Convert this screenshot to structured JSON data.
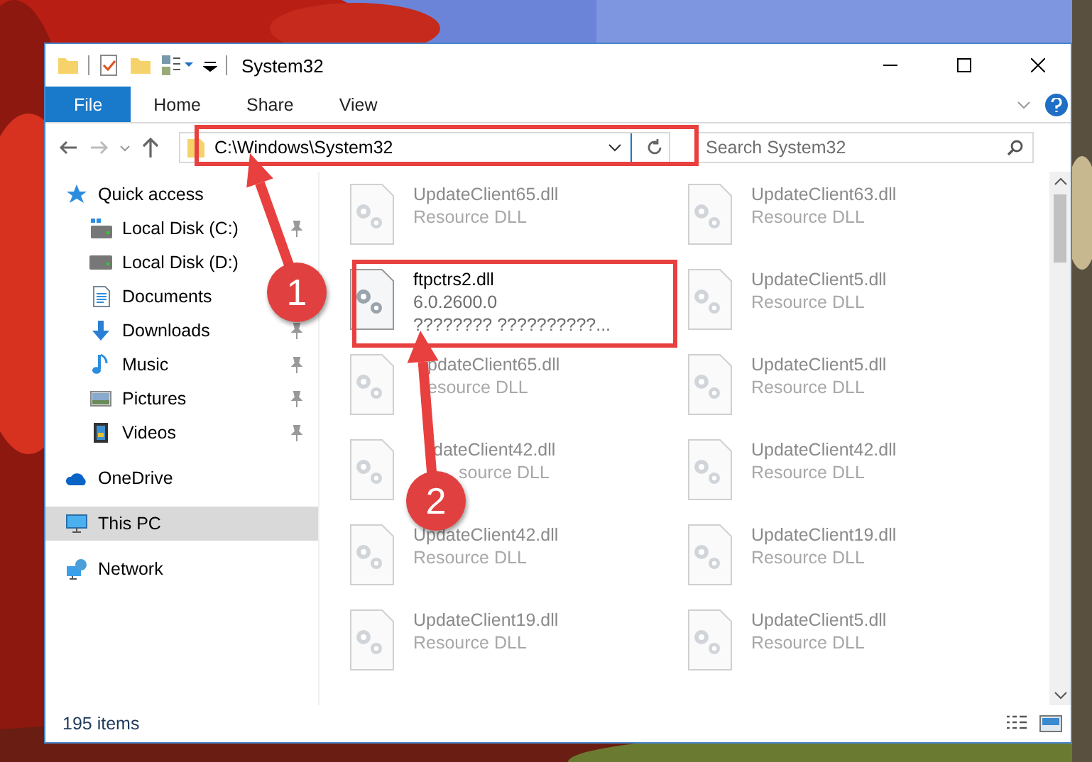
{
  "window": {
    "title": "System32"
  },
  "ribbon_tabs": [
    {
      "label": "File",
      "kind": "file",
      "selected": false
    },
    {
      "label": "Home",
      "kind": "tab",
      "selected": false
    },
    {
      "label": "Share",
      "kind": "tab",
      "selected": false
    },
    {
      "label": "View",
      "kind": "tab",
      "selected": false
    }
  ],
  "address_bar": {
    "path": "C:\\Windows\\System32"
  },
  "search": {
    "placeholder": "Search System32"
  },
  "sidebar": {
    "items": [
      {
        "label": "Quick access",
        "kind": "star",
        "selected": false,
        "children": [
          {
            "label": "Local Disk (C:)",
            "kind": "drive_c",
            "pinned": true
          },
          {
            "label": "Local Disk (D:)",
            "kind": "drive",
            "pinned": false
          },
          {
            "label": "Documents",
            "kind": "documents",
            "pinned": false
          },
          {
            "label": "Downloads",
            "kind": "downloads",
            "pinned": true
          },
          {
            "label": "Music",
            "kind": "music",
            "pinned": true
          },
          {
            "label": "Pictures",
            "kind": "pictures",
            "pinned": true
          },
          {
            "label": "Videos",
            "kind": "videos",
            "pinned": true
          }
        ]
      },
      {
        "label": "OneDrive",
        "kind": "cloud",
        "selected": false
      },
      {
        "label": "This PC",
        "kind": "pc",
        "selected": true
      },
      {
        "label": "Network",
        "kind": "network",
        "selected": false
      }
    ]
  },
  "files": [
    {
      "name": "UpdateClient65.dll",
      "type": "Resource DLL",
      "blurred": true
    },
    {
      "name": "UpdateClient63.dll",
      "type": "Resource DLL",
      "blurred": true
    },
    {
      "name": "ftpctrs2.dll",
      "version": "6.0.2600.0",
      "description": "???????? ??????????...",
      "blurred": false
    },
    {
      "name": "UpdateClient5.dll",
      "type": "Resource DLL",
      "blurred": true
    },
    {
      "name": "pdateClient65.dll",
      "type": "esource DLL",
      "blurred": true
    },
    {
      "name": "UpdateClient5.dll",
      "type": "Resource DLL",
      "blurred": true
    },
    {
      "name": "dateClient42.dll",
      "type": "source DLL",
      "blurred": true
    },
    {
      "name": "UpdateClient42.dll",
      "type": "Resource DLL",
      "blurred": true
    },
    {
      "name": "UpdateClient42.dll",
      "type": "Resource DLL",
      "blurred": true
    },
    {
      "name": "UpdateClient19.dll",
      "type": "Resource DLL",
      "blurred": true
    },
    {
      "name": "UpdateClient19.dll",
      "type": "Resource DLL",
      "blurred": true
    },
    {
      "name": "UpdateClient5.dll",
      "type": "Resource DLL",
      "blurred": true
    }
  ],
  "status_bar": {
    "item_count": "195 items"
  },
  "annotations": [
    {
      "number": "1"
    },
    {
      "number": "2"
    }
  ]
}
